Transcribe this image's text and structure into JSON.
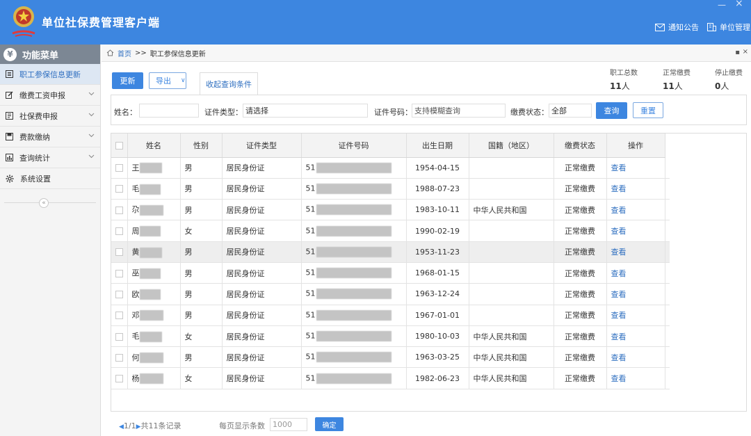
{
  "app": {
    "title": "单位社保费管理客户端",
    "window_min": "—",
    "window_close": "×",
    "notice_label": "通知公告",
    "unit_mgmt_label": "单位管理"
  },
  "sidebar": {
    "header": "功能菜单",
    "header_icon": "¥",
    "collapse": "«",
    "items": [
      {
        "label": "职工参保信息更新",
        "icon": "list-icon",
        "active": true
      },
      {
        "label": "缴费工资申报",
        "icon": "edit-icon",
        "expandable": true
      },
      {
        "label": "社保费申报",
        "icon": "document-icon",
        "expandable": true
      },
      {
        "label": "费款缴纳",
        "icon": "save-icon",
        "expandable": true
      },
      {
        "label": "查询统计",
        "icon": "bar-chart-icon",
        "expandable": true
      },
      {
        "label": "系统设置",
        "icon": "gear-icon"
      }
    ]
  },
  "breadcrumb": {
    "home": "首页",
    "sep": ">>",
    "current": "职工参保信息更新",
    "close_icons": [
      "▪",
      "×"
    ]
  },
  "toolbar": {
    "update": "更新",
    "export": "导出",
    "export_caret": "∨",
    "collapse_query": "收起查询条件"
  },
  "stats": [
    {
      "label": "职工总数",
      "value": "11",
      "unit": "人"
    },
    {
      "label": "正常缴费",
      "value": "11",
      "unit": "人"
    },
    {
      "label": "停止缴费",
      "value": "0",
      "unit": "人"
    }
  ],
  "filters": {
    "name_label": "姓名：",
    "name_value": "",
    "idtype_label": "证件类型：",
    "idtype_value": "请选择",
    "idno_label": "证件号码：",
    "idno_placeholder": "支持模糊查询",
    "status_label": "缴费状态：",
    "status_value": "全部",
    "query": "查询",
    "reset": "重置"
  },
  "table": {
    "columns": [
      "姓名",
      "性别",
      "证件类型",
      "证件号码",
      "出生日期",
      "国籍（地区）",
      "缴费状态",
      "操作"
    ],
    "rows": [
      {
        "name": "王",
        "gender": "男",
        "id_type": "居民身份证",
        "id_no": "51",
        "birth": "1954-04-15",
        "nationality": "",
        "status": "正常缴费",
        "action": "查看"
      },
      {
        "name": "毛",
        "gender": "男",
        "id_type": "居民身份证",
        "id_no": "51",
        "birth": "1988-07-23",
        "nationality": "",
        "status": "正常缴费",
        "action": "查看"
      },
      {
        "name": "尕",
        "gender": "男",
        "id_type": "居民身份证",
        "id_no": "51",
        "birth": "1983-10-11",
        "nationality": "中华人民共和国",
        "status": "正常缴费",
        "action": "查看"
      },
      {
        "name": "周",
        "gender": "女",
        "id_type": "居民身份证",
        "id_no": "51",
        "birth": "1990-02-19",
        "nationality": "",
        "status": "正常缴费",
        "action": "查看"
      },
      {
        "name": "黄",
        "gender": "男",
        "id_type": "居民身份证",
        "id_no": "51",
        "birth": "1953-11-23",
        "nationality": "",
        "status": "正常缴费",
        "action": "查看"
      },
      {
        "name": "巫",
        "gender": "男",
        "id_type": "居民身份证",
        "id_no": "51",
        "birth": "1968-01-15",
        "nationality": "",
        "status": "正常缴费",
        "action": "查看"
      },
      {
        "name": "欧",
        "gender": "男",
        "id_type": "居民身份证",
        "id_no": "51",
        "birth": "1963-12-24",
        "nationality": "",
        "status": "正常缴费",
        "action": "查看"
      },
      {
        "name": "邓",
        "gender": "男",
        "id_type": "居民身份证",
        "id_no": "51",
        "birth": "1967-01-01",
        "nationality": "",
        "status": "正常缴费",
        "action": "查看"
      },
      {
        "name": "毛",
        "gender": "女",
        "id_type": "居民身份证",
        "id_no": "51",
        "birth": "1980-10-03",
        "nationality": "中华人民共和国",
        "status": "正常缴费",
        "action": "查看"
      },
      {
        "name": "何",
        "gender": "男",
        "id_type": "居民身份证",
        "id_no": "51",
        "birth": "1963-03-25",
        "nationality": "中华人民共和国",
        "status": "正常缴费",
        "action": "查看"
      },
      {
        "name": "杨",
        "gender": "女",
        "id_type": "居民身份证",
        "id_no": "51",
        "birth": "1982-06-23",
        "nationality": "中华人民共和国",
        "status": "正常缴费",
        "action": "查看"
      }
    ],
    "highlighted_row": 4
  },
  "pager": {
    "prev": "◀",
    "page": "1/1",
    "next": "▶",
    "total": "共11条记录",
    "per_page_label": "每页显示条数",
    "per_page_value": "1000",
    "confirm": "确定"
  },
  "colors": {
    "brand_blue": "#3d86e0",
    "link_blue": "#2f6fc0",
    "sidebar_header": "#7c8794"
  }
}
